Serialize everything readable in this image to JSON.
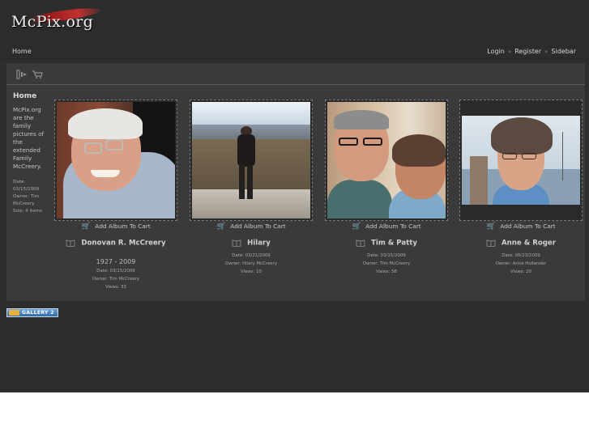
{
  "site": {
    "logo_text": "McPix.org"
  },
  "nav": {
    "home": "Home",
    "login": "Login",
    "register": "Register",
    "sidebar": "Sidebar",
    "separator": "»"
  },
  "toolbar": {
    "icons": [
      "view-slideshow-icon",
      "cart-icon"
    ]
  },
  "sidebar": {
    "title": "Home",
    "description": "McPix.org are the family pictures of the extended Family McCreery.",
    "meta": [
      "Date: 03/15/2009",
      "Owner: Tim McCreery",
      "Size: 4 items"
    ]
  },
  "albums": [
    {
      "cart_label": "Add Album To Cart",
      "title": "Donovan R. McCreery",
      "extra": "1927 - 2009",
      "date": "Date: 03/15/2009",
      "owner": "Owner: Tim McCreery",
      "views": "Views: 33"
    },
    {
      "cart_label": "Add Album To Cart",
      "title": "Hilary",
      "date": "Date: 03/21/2009",
      "owner": "Owner: Hilary McCreery",
      "views": "Views: 10"
    },
    {
      "cart_label": "Add Album To Cart",
      "title": "Tim & Patty",
      "date": "Date: 03/15/2009",
      "owner": "Owner: Tim McCreery",
      "views": "Views: 58"
    },
    {
      "cart_label": "Add Album To Cart",
      "title": "Anne & Roger",
      "date": "Date: 06/23/2009",
      "owner": "Owner: Anne Hollander",
      "views": "Views: 20"
    }
  ],
  "footer": {
    "badge_text": "GALLERY 2"
  },
  "colors": {
    "background": "#2e2e2e",
    "panel": "#3a3a3a",
    "logo_accent": "#c23030"
  }
}
